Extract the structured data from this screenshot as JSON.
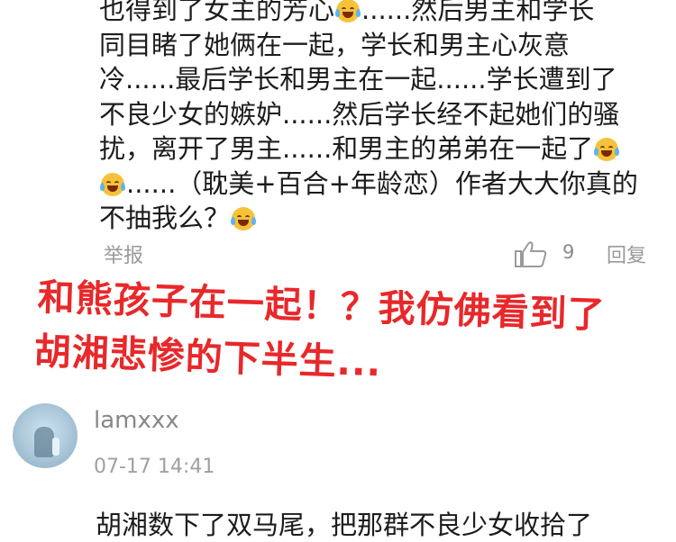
{
  "comment1": {
    "lines": [
      "也得到了女主的芳心",
      "同目睹了她俩在一起，学长和男主心灰意",
      "冷......最后学长和男主在一起......学长遭到了",
      "不良少女的嫉妒......然后学长经不起她们的骚",
      "扰，离开了男主......和男主的弟弟在一起了",
      "......（耽美+百合+年龄恋）作者大大你真的",
      "不抽我么？"
    ],
    "line1_tail": "......然后男主和学长",
    "emoji": "laugh-cry-emoji",
    "report_label": "举报",
    "like_count": "9",
    "reply_label": "回复"
  },
  "overlay": {
    "line1": "和熊孩子在一起！？我仿佛看到了",
    "line2": "胡湘悲惨的下半生...",
    "color": "#e8282a"
  },
  "comment2": {
    "username": "lamxxx",
    "timestamp": "07-17 14:41",
    "body": "胡湘数下了双马尾，把那群不良少女收拾了"
  }
}
